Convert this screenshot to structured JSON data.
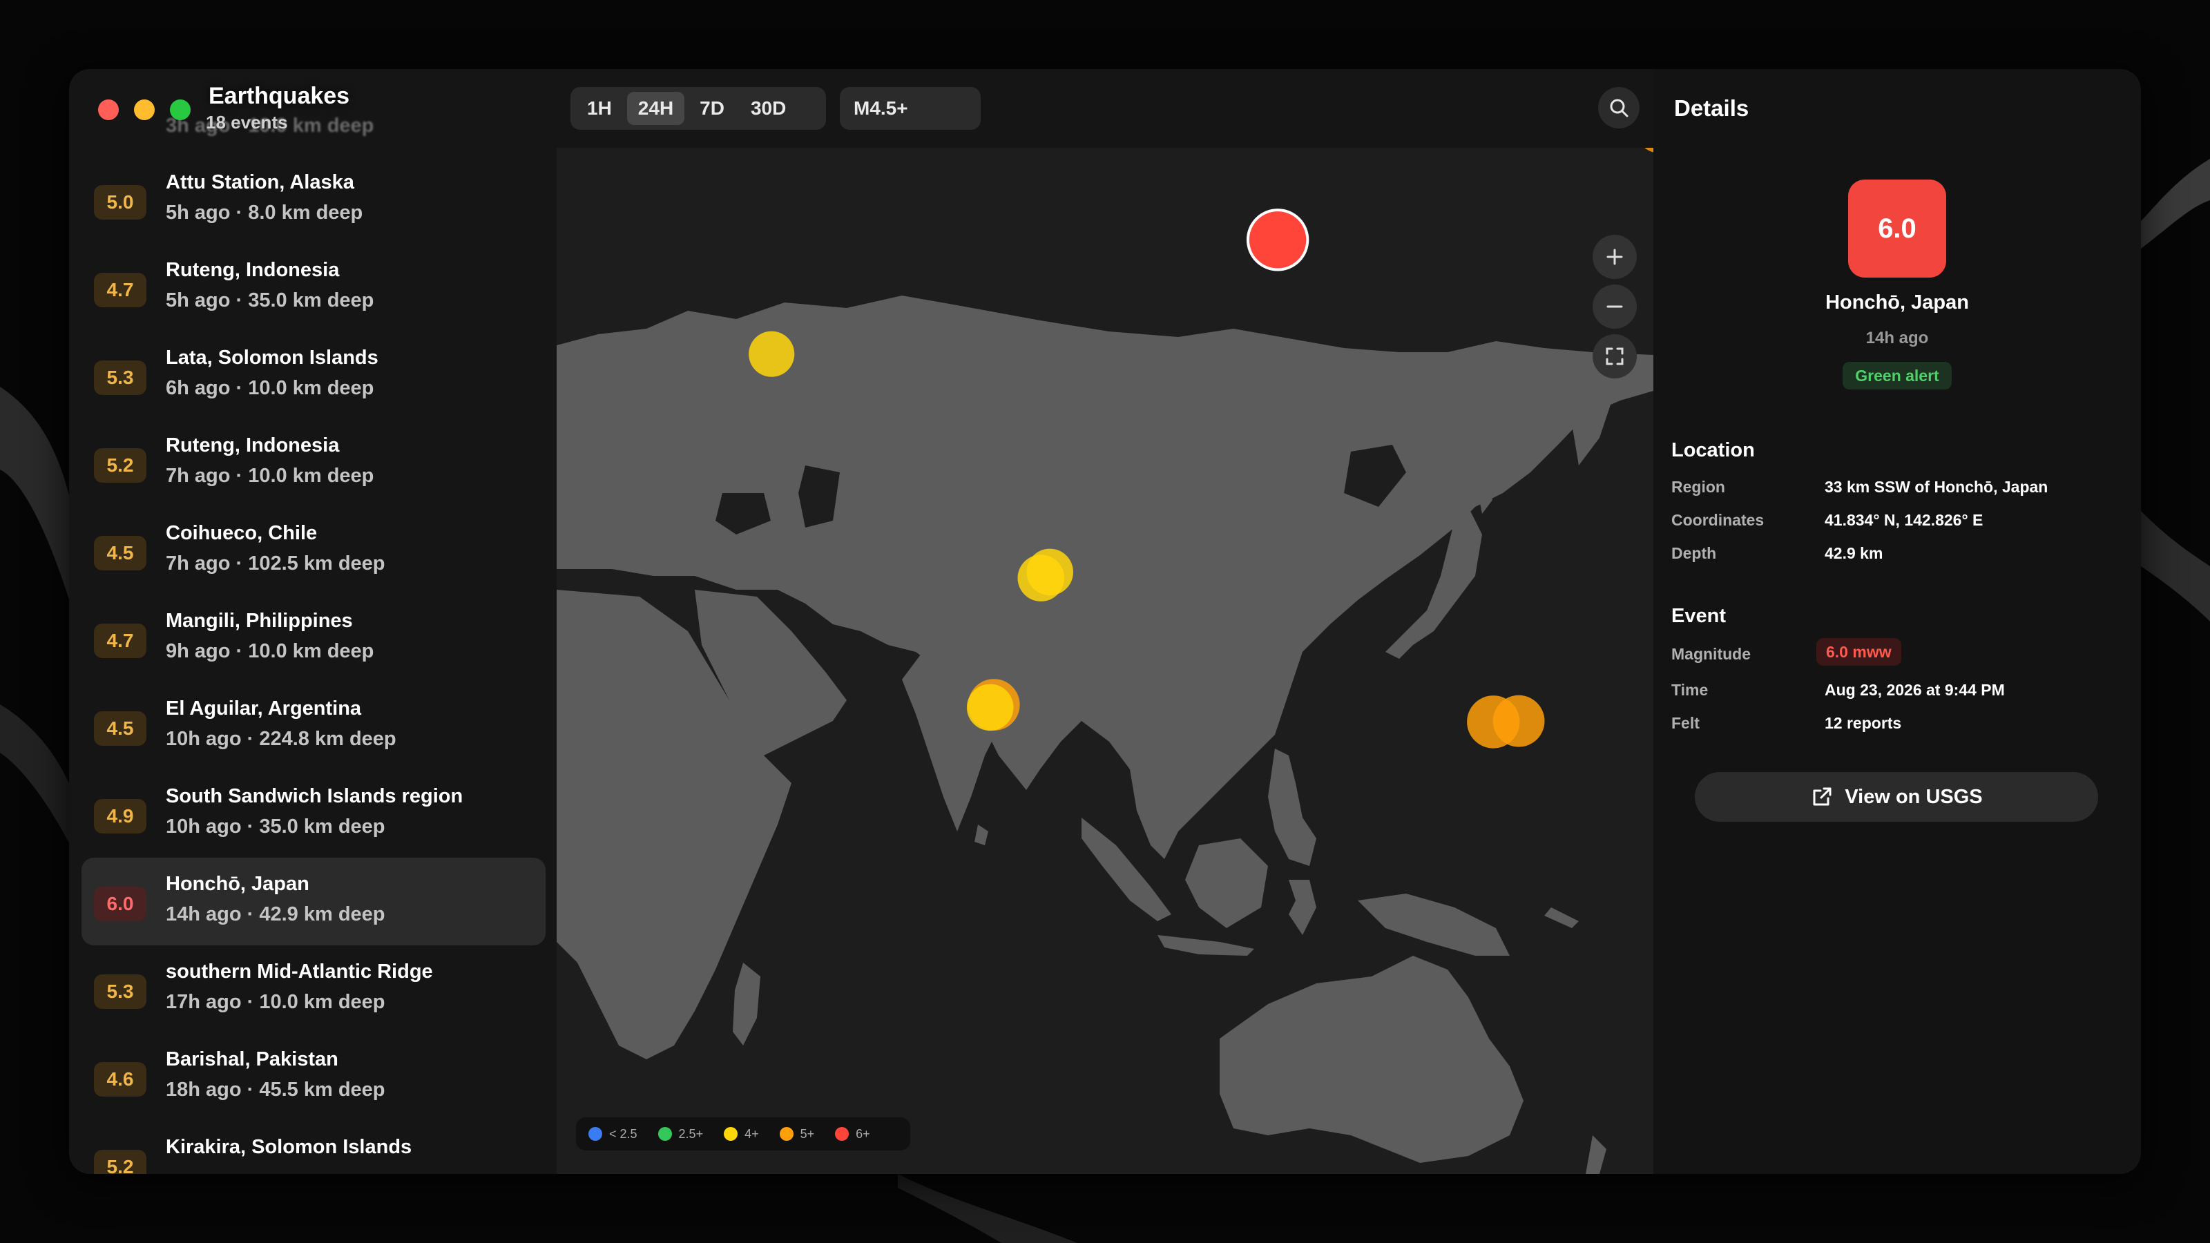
{
  "app": {
    "title": "Earthquakes",
    "count_label": "18 events",
    "ghost_row_meta": "3h ago · 10.0 km deep"
  },
  "colors": {
    "mag_under_2_5": "#3b7cf5",
    "mag_2_5": "#34c759",
    "mag_4": "#ffd60a",
    "mag_5": "#ff9f0a",
    "mag_6": "#ff453a",
    "land": "#5c5c5c",
    "ocean": "#1d1d1d"
  },
  "earthquakes": [
    {
      "mag": "5.0",
      "place": "Attu Station, Alaska",
      "meta": "5h ago · 8.0 km deep"
    },
    {
      "mag": "4.7",
      "place": "Ruteng, Indonesia",
      "meta": "5h ago · 35.0 km deep"
    },
    {
      "mag": "5.3",
      "place": "Lata, Solomon Islands",
      "meta": "6h ago · 10.0 km deep"
    },
    {
      "mag": "5.2",
      "place": "Ruteng, Indonesia",
      "meta": "7h ago · 10.0 km deep"
    },
    {
      "mag": "4.5",
      "place": "Coihueco, Chile",
      "meta": "7h ago · 102.5 km deep"
    },
    {
      "mag": "4.7",
      "place": "Mangili, Philippines",
      "meta": "9h ago · 10.0 km deep"
    },
    {
      "mag": "4.5",
      "place": "El Aguilar, Argentina",
      "meta": "10h ago · 224.8 km deep"
    },
    {
      "mag": "4.9",
      "place": "South Sandwich Islands region",
      "meta": "10h ago · 35.0 km deep"
    },
    {
      "mag": "6.0",
      "place": "Honchō, Japan",
      "meta": "14h ago · 42.9 km deep",
      "selected": true
    },
    {
      "mag": "5.3",
      "place": "southern Mid-Atlantic Ridge",
      "meta": "17h ago · 10.0 km deep"
    },
    {
      "mag": "4.6",
      "place": "Barishal, Pakistan",
      "meta": "18h ago · 45.5 km deep"
    },
    {
      "mag": "5.2",
      "place": "Kirakira, Solomon Islands",
      "meta": ""
    }
  ],
  "toolbar": {
    "ranges": [
      "1H",
      "24H",
      "7D",
      "30D"
    ],
    "active_range": "24H",
    "mag_filter": "M4.5+"
  },
  "legend": [
    {
      "label": "< 2.5",
      "color": "#3b7cf5"
    },
    {
      "label": "2.5+",
      "color": "#34c759"
    },
    {
      "label": "4+",
      "color": "#ffd60a"
    },
    {
      "label": "5+",
      "color": "#ff9f0a"
    },
    {
      "label": "6+",
      "color": "#ff453a"
    }
  ],
  "map_markers": [
    {
      "lon": 142.83,
      "lat": 41.83,
      "mag": 6.0,
      "selected": true
    },
    {
      "lon": 172.9,
      "lat": 52.9,
      "mag": 5.0
    },
    {
      "lon": 75.0,
      "lat": 36.6,
      "mag": 4.6
    },
    {
      "lon": 103.0,
      "lat": 30.5,
      "mag": 4.6
    },
    {
      "lon": 124.9,
      "lat": 6.9,
      "mag": 4.7
    },
    {
      "lon": 124.2,
      "lat": 6.2,
      "mag": 4.7
    },
    {
      "lon": 120.5,
      "lat": -8.6,
      "mag": 5.2
    },
    {
      "lon": 120.2,
      "lat": -8.9,
      "mag": 4.7
    },
    {
      "lon": 159.8,
      "lat": -10.6,
      "mag": 5.3
    },
    {
      "lon": 161.8,
      "lat": -10.5,
      "mag": 5.2
    }
  ],
  "details": {
    "title": "Details",
    "magnitude": "6.0",
    "place": "Honchō, Japan",
    "when": "14h ago",
    "alert": "Green alert",
    "location_heading": "Location",
    "region_label": "Region",
    "region": "33 km SSW of Honchō, Japan",
    "coords_label": "Coordinates",
    "coords": "41.834° N, 142.826° E",
    "depth_label": "Depth",
    "depth": "42.9 km",
    "event_heading": "Event",
    "magnitude_label": "Magnitude",
    "magnitude_value": "6.0 mww",
    "time_label": "Time",
    "time": "Aug 23, 2026 at 9:44 PM",
    "felt_label": "Felt",
    "felt": "12 reports",
    "usgs_button": "View on USGS"
  },
  "icons": {
    "search": "magnifier-icon",
    "zoom_in": "plus-icon",
    "zoom_out": "minus-icon",
    "fullscreen": "expand-icon",
    "external": "external-link-icon"
  }
}
